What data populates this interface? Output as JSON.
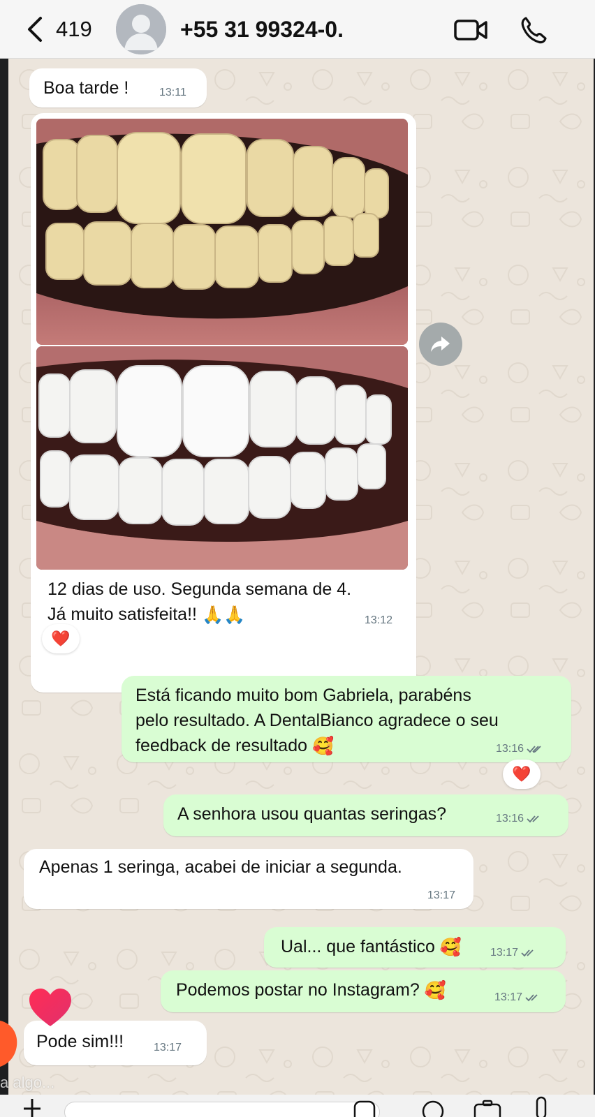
{
  "header": {
    "unread_count": "419",
    "contact_name": "+55 31 99324-0.  "
  },
  "messages": [
    {
      "id": "m1",
      "direction": "in",
      "text": "Boa tarde !",
      "time": "13:11"
    },
    {
      "id": "m2",
      "direction": "in",
      "text_line1": "12 dias de uso. Segunda semana de 4.",
      "text_line2": "Já muito satisfeita!!",
      "emoji": "🙏🙏",
      "time": "13:12",
      "reaction": "❤️"
    },
    {
      "id": "m3",
      "direction": "out",
      "text_line1": "Está ficando muito bom Gabriela, parabéns",
      "text_line2": "pelo resultado. A DentalBianco agradece o seu",
      "text_line3": "feedback de resultado",
      "emoji": "🥰",
      "time": "13:16",
      "reaction": "❤️"
    },
    {
      "id": "m4",
      "direction": "out",
      "text": "A senhora usou quantas seringas?",
      "time": "13:16"
    },
    {
      "id": "m5",
      "direction": "in",
      "text": "Apenas 1 seringa, acabei de iniciar a segunda.",
      "time": "13:17"
    },
    {
      "id": "m6",
      "direction": "out",
      "text": "Ual... que fantástico",
      "emoji": "🥰",
      "time": "13:17"
    },
    {
      "id": "m7",
      "direction": "out",
      "text": "Podemos postar no Instagram?",
      "emoji": "🥰",
      "time": "13:17"
    },
    {
      "id": "m8",
      "direction": "in",
      "text": "Pode sim!!!",
      "time": "13:17"
    }
  ],
  "story_overlay": {
    "reply_hint": "a algo..."
  },
  "colors": {
    "incoming_bubble": "#ffffff",
    "outgoing_bubble": "#d9fdd3",
    "chat_background": "#ece5dc",
    "reaction_heart": "#e0245e"
  }
}
